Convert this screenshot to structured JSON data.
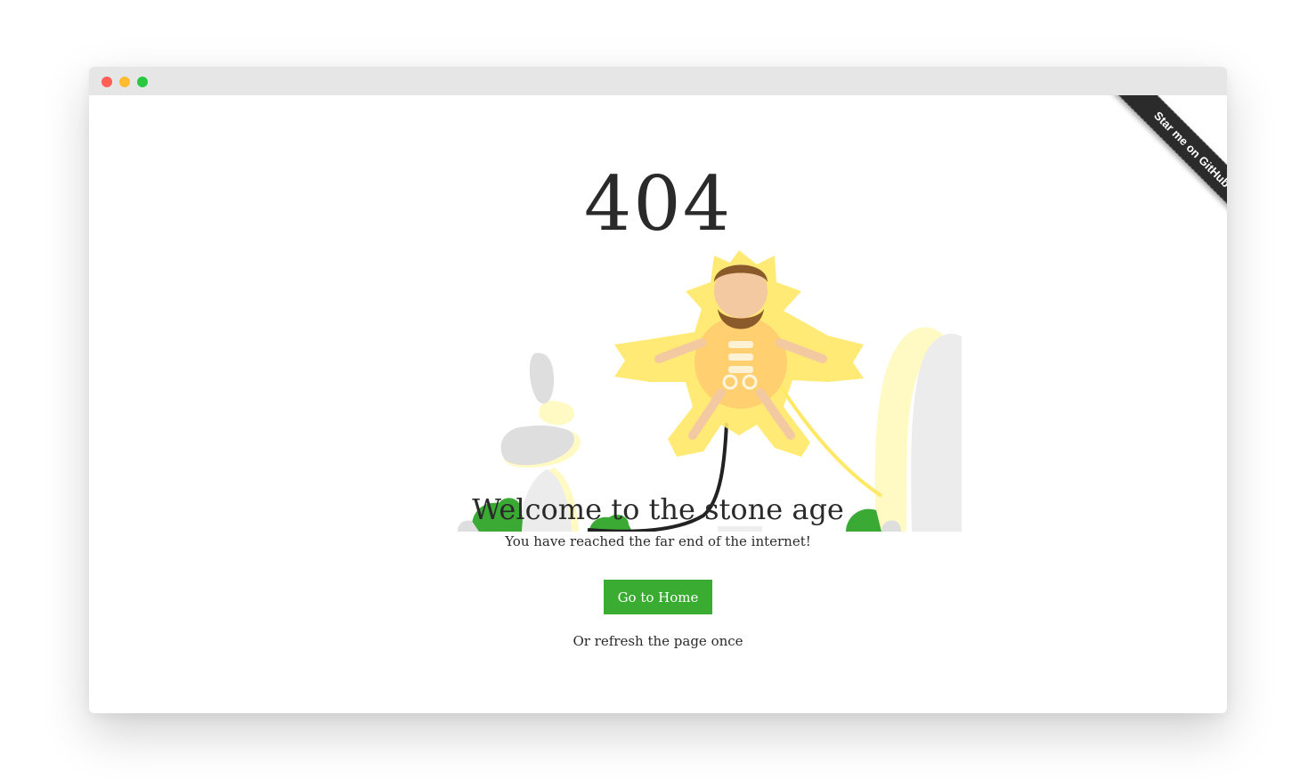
{
  "window": {
    "controls": [
      "close",
      "minimize",
      "maximize"
    ]
  },
  "ribbon": {
    "label": "Star me on GitHub"
  },
  "error": {
    "code": "404",
    "title": "Welcome to the stone age",
    "subtitle": "You have reached the far end of the internet!",
    "button_label": "Go to Home",
    "hint": "Or refresh the page once"
  },
  "colors": {
    "close": "#ff5f57",
    "minimize": "#febc2e",
    "maximize": "#28c840",
    "button": "#39ac31",
    "bush": "#3aaa34",
    "glow": "#ffe866",
    "stone": "#dedede"
  }
}
